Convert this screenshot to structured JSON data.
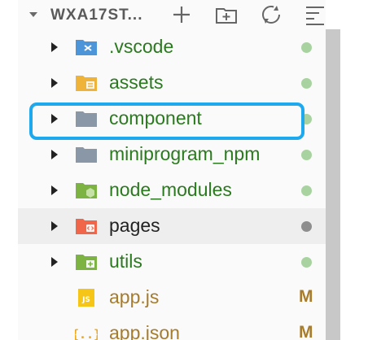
{
  "header": {
    "title": "WXA17ST...",
    "actions": [
      {
        "name": "new-file-icon"
      },
      {
        "name": "new-folder-icon"
      },
      {
        "name": "refresh-icon"
      },
      {
        "name": "collapse-all-icon"
      }
    ]
  },
  "tree": [
    {
      "label": ".vscode",
      "type": "folder",
      "icon": "vscode-folder-icon",
      "color": "#2a7a1e",
      "status": "dot-green"
    },
    {
      "label": "assets",
      "type": "folder",
      "icon": "assets-folder-icon",
      "color": "#2a7a1e",
      "status": "dot-green"
    },
    {
      "label": "component",
      "type": "folder",
      "icon": "folder-icon",
      "color": "#2a7a1e",
      "status": "dot-green",
      "highlighted": true
    },
    {
      "label": "miniprogram_npm",
      "type": "folder",
      "icon": "folder-icon",
      "color": "#2a7a1e",
      "status": "dot-green"
    },
    {
      "label": "node_modules",
      "type": "folder",
      "icon": "node-folder-icon",
      "color": "#2a7a1e",
      "status": "dot-green"
    },
    {
      "label": "pages",
      "type": "folder",
      "icon": "pages-folder-icon",
      "color": "#222222",
      "status": "dot-grey",
      "hovered": true
    },
    {
      "label": "utils",
      "type": "folder",
      "icon": "utils-folder-icon",
      "color": "#2a7a1e",
      "status": "dot-green"
    },
    {
      "label": "app.js",
      "type": "file",
      "icon": "js-file-icon",
      "color": "#a67c2e",
      "status_text": "M"
    },
    {
      "label": "app.json",
      "type": "file",
      "icon": "json-file-icon",
      "color": "#a67c2e",
      "status_text": "M"
    }
  ],
  "colors": {
    "highlight": "#1ea9ef",
    "modified": "#a67c2e",
    "untracked": "#2a7a1e"
  }
}
